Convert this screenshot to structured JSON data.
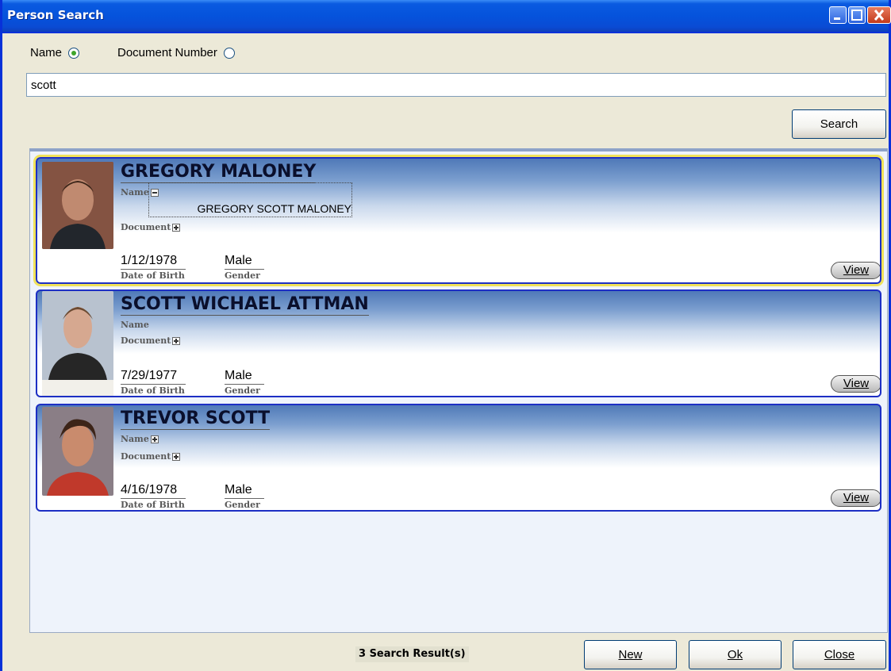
{
  "window": {
    "title": "Person Search"
  },
  "search": {
    "options": [
      {
        "label": "Name",
        "checked": true
      },
      {
        "label": "Document Number",
        "checked": false
      }
    ],
    "query": "scott",
    "button_label": "Search"
  },
  "results": [
    {
      "name": "GREGORY MALONEY",
      "name_label": "Name",
      "name_expanded": true,
      "full_name": "GREGORY SCOTT MALONEY",
      "document_label": "Document",
      "dob": "1/12/1978",
      "dob_label": "Date of Birth",
      "gender": "Male",
      "gender_label": "Gender",
      "view_label": "View",
      "selected": true
    },
    {
      "name": "SCOTT WICHAEL ATTMAN",
      "name_label": "Name",
      "document_label": "Document",
      "dob": "7/29/1977",
      "dob_label": "Date of Birth",
      "gender": "Male",
      "gender_label": "Gender",
      "view_label": "View"
    },
    {
      "name": "TREVOR SCOTT",
      "name_label": "Name",
      "document_label": "Document",
      "dob": "4/16/1978",
      "dob_label": "Date of Birth",
      "gender": "Male",
      "gender_label": "Gender",
      "view_label": "View"
    }
  ],
  "footer": {
    "status": "3 Search Result(s)",
    "new_label": "New",
    "ok_label": "Ok",
    "close_label": "Close"
  },
  "icons": [
    "window-minimize-icon",
    "window-maximize-icon",
    "window-close-icon",
    "expand-plus-icon",
    "collapse-minus-icon"
  ],
  "colors": {
    "titlebar": "#0553dc",
    "card_border": "#1d2fc4",
    "selected_outline": "#f0e25a"
  }
}
